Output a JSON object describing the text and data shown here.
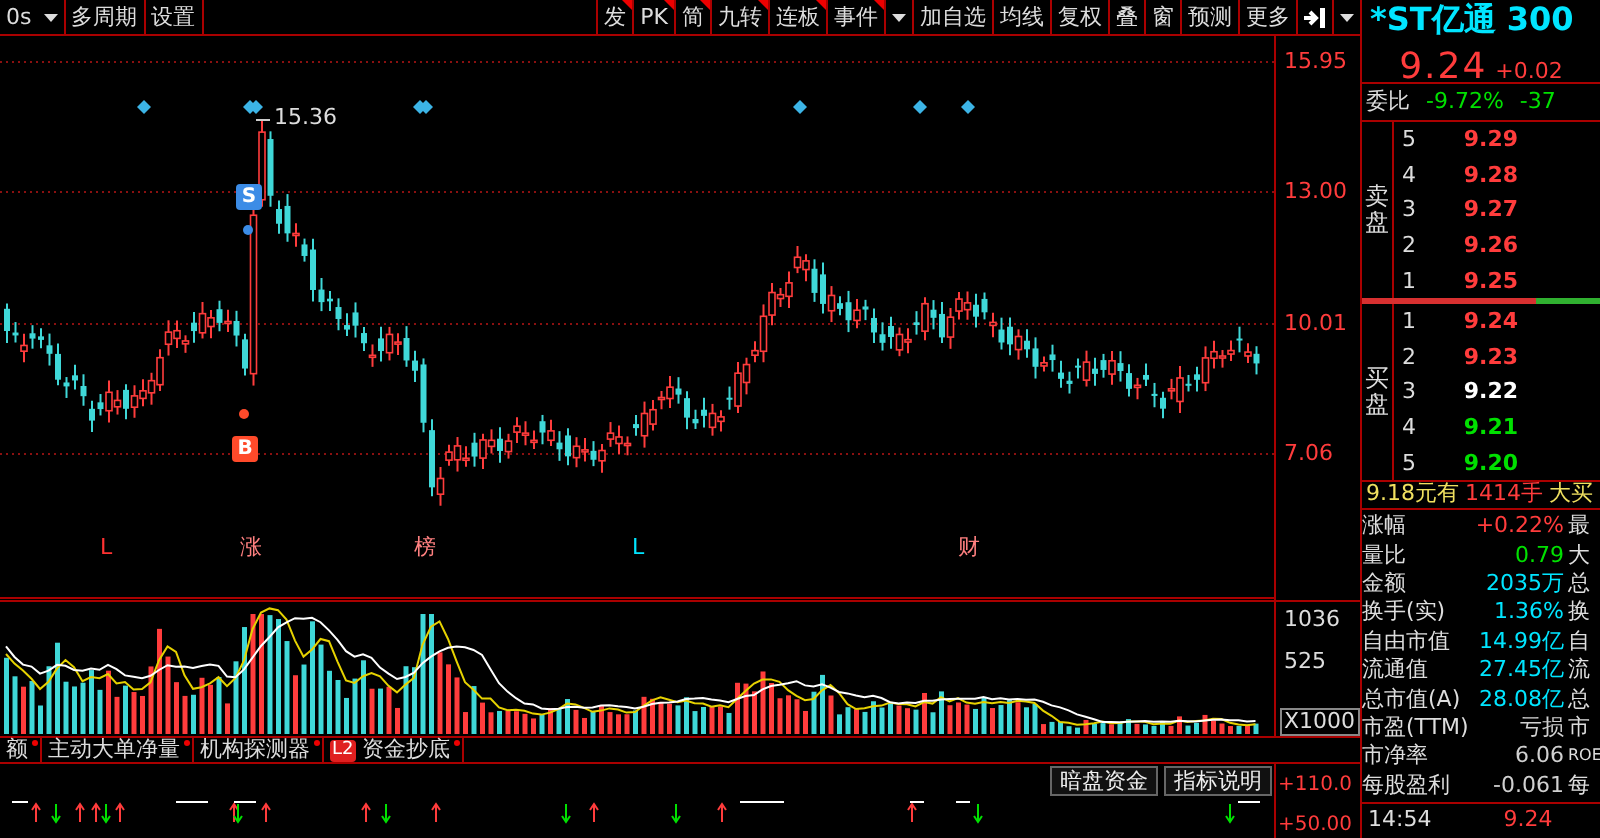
{
  "toolbar": {
    "period": "0s",
    "left_buttons": [
      "多周期",
      "设置"
    ],
    "right_buttons": [
      {
        "label": "发",
        "marked": true
      },
      {
        "label": "PK",
        "marked": true
      },
      {
        "label": "简",
        "marked": true
      },
      {
        "label": "九转",
        "marked": true
      },
      {
        "label": "连板",
        "marked": true
      },
      {
        "label": "事件",
        "marked": true
      },
      {
        "label": "加自选",
        "marked": false
      },
      {
        "label": "均线",
        "marked": false
      },
      {
        "label": "复权",
        "marked": false
      },
      {
        "label": "叠",
        "marked": false
      },
      {
        "label": "窗",
        "marked": false
      },
      {
        "label": "预测",
        "marked": false
      },
      {
        "label": "更多",
        "marked": false
      }
    ]
  },
  "chart": {
    "price_ticks": [
      "15.95",
      "13.00",
      "10.01",
      "7.06"
    ],
    "peak_label": "15.36",
    "signals": [
      {
        "text": "S",
        "kind": "sell"
      },
      {
        "text": "B",
        "kind": "buy"
      }
    ],
    "event_labels": [
      {
        "text": "L",
        "color": "#ff3232"
      },
      {
        "text": "涨",
        "color": "#ff8080"
      },
      {
        "text": "榜",
        "color": "#ff8080"
      },
      {
        "text": "L",
        "color": "#00e5ff"
      },
      {
        "text": "财",
        "color": "#ff8080"
      }
    ]
  },
  "volume": {
    "ticks": [
      "1036",
      "525"
    ],
    "unit": "X1000"
  },
  "indicator_tabs": [
    {
      "label": "额"
    },
    {
      "label": "主动大单净量"
    },
    {
      "label": "机构探测器"
    },
    {
      "label": "资金抄底",
      "badge": "L2"
    }
  ],
  "signal_panel": {
    "buttons": [
      "暗盘资金",
      "指标说明"
    ],
    "ticks": [
      "+110.0",
      "+50.00"
    ]
  },
  "quote": {
    "title": "*ST亿通 300",
    "price": "9.24",
    "change": "+0.02",
    "ratio_label": "委比",
    "ratio_value": "-9.72%",
    "ratio_diff": "-37",
    "sell_label": "卖盘",
    "asks": [
      {
        "level": "5",
        "price": "9.29",
        "color": "#ff3c3c"
      },
      {
        "level": "4",
        "price": "9.28",
        "color": "#ff3c3c"
      },
      {
        "level": "3",
        "price": "9.27",
        "color": "#ff3c3c"
      },
      {
        "level": "2",
        "price": "9.26",
        "color": "#ff3c3c"
      },
      {
        "level": "1",
        "price": "9.25",
        "color": "#ff3c3c"
      }
    ],
    "ratio_bar": {
      "level": 0.73
    },
    "buy_label": "买盘",
    "bids": [
      {
        "level": "1",
        "price": "9.24",
        "color": "#ff3c3c"
      },
      {
        "level": "2",
        "price": "9.23",
        "color": "#ff3c3c"
      },
      {
        "level": "3",
        "price": "9.22",
        "color": "#ffffff"
      },
      {
        "level": "4",
        "price": "9.21",
        "color": "#00e000"
      },
      {
        "level": "5",
        "price": "9.20",
        "color": "#00e000"
      }
    ],
    "big_order": {
      "price": "9.18元有",
      "volume": "1414手",
      "side": "大买"
    },
    "stats": [
      {
        "label": "涨幅",
        "value": "+0.22%",
        "color": "#ff3c3c",
        "next": "最"
      },
      {
        "label": "量比",
        "value": "0.79",
        "color": "#00e000",
        "next": "大"
      },
      {
        "label": "金额",
        "value": "2035万",
        "color": "#00e5ff",
        "next": "总"
      },
      {
        "label": "换手(实)",
        "value": "1.36%",
        "color": "#00e5ff",
        "next": "换"
      },
      {
        "label": "自由市值",
        "value": "14.99亿",
        "color": "#00e5ff",
        "next": "自"
      },
      {
        "label": "流通值",
        "value": "27.45亿",
        "color": "#00e5ff",
        "next": "流"
      },
      {
        "label": "总市值(A)",
        "value": "28.08亿",
        "color": "#00e5ff",
        "next": "总"
      },
      {
        "label": "市盈(TTM)",
        "value": "亏损",
        "color": "#d0d0d0",
        "next": "市"
      },
      {
        "label": "市净率",
        "value": "6.06",
        "color": "#d0d0d0",
        "next": "ROE"
      },
      {
        "label": "每股盈利",
        "value": "-0.061",
        "color": "#d0d0d0",
        "next": "每"
      }
    ],
    "last_trade": {
      "time": "14:54",
      "price": "9.24"
    }
  }
}
